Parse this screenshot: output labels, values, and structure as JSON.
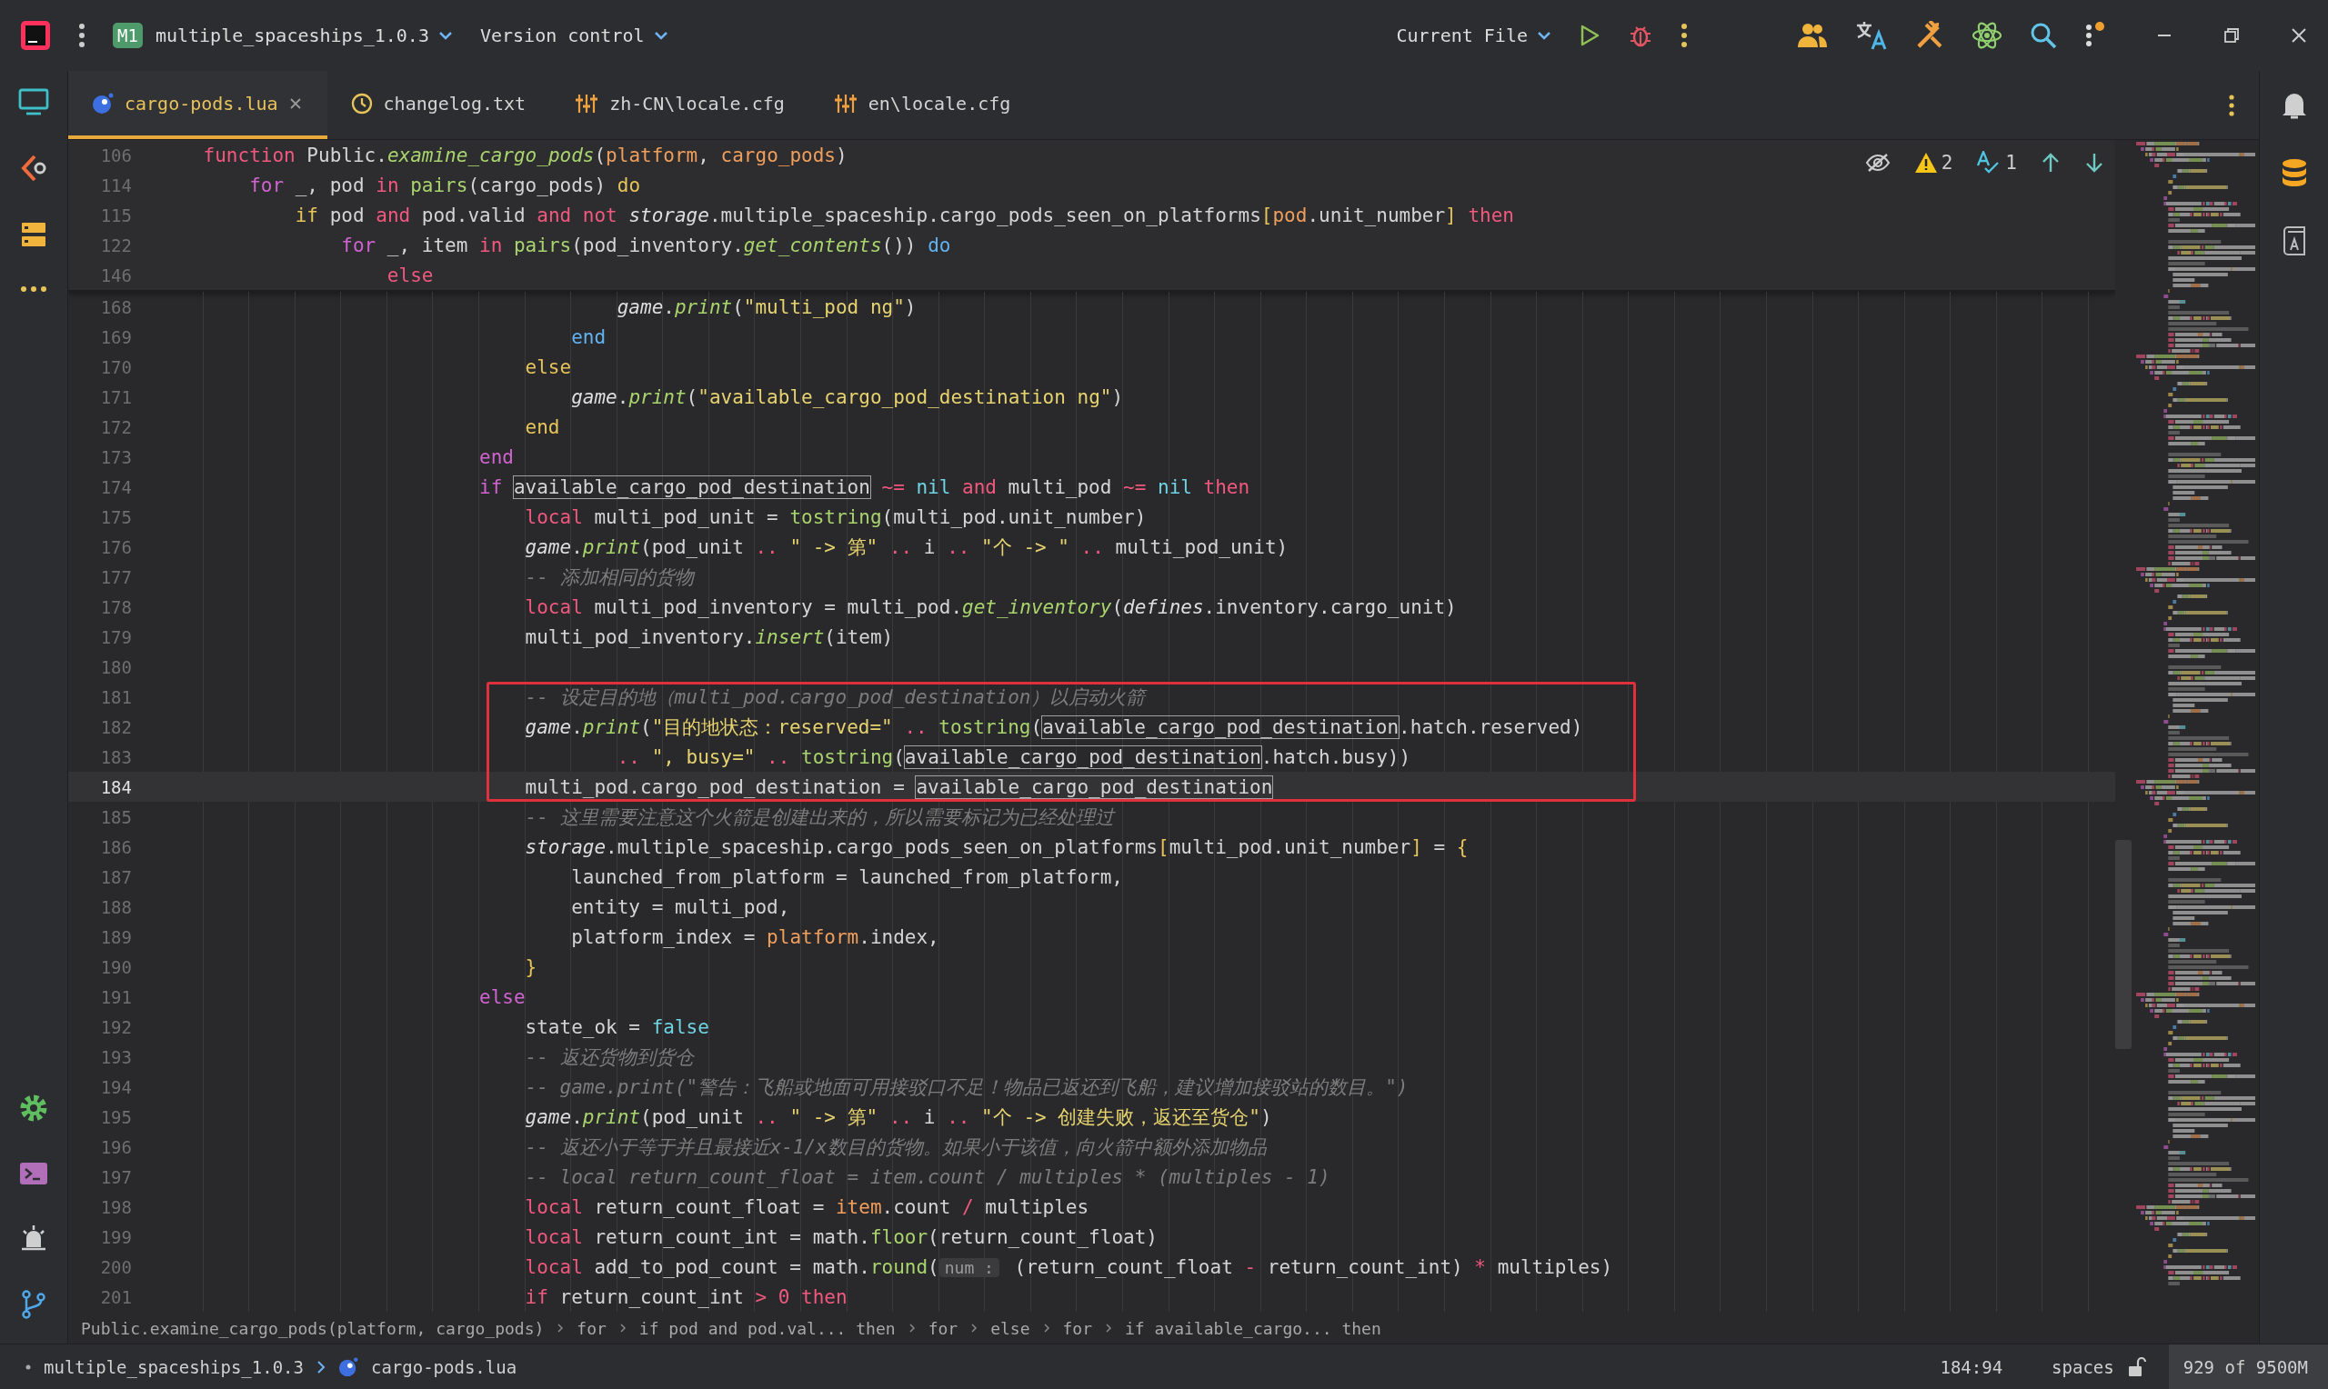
{
  "title_bar": {
    "project_badge": "M1",
    "project": "multiple_spaceships_1.0.3",
    "vcs": "Version control",
    "run_config": "Current File"
  },
  "tabs": [
    {
      "label": "cargo-pods.lua",
      "kind": "lua",
      "selected": true
    },
    {
      "label": "changelog.txt",
      "kind": "history",
      "selected": false
    },
    {
      "label": "zh-CN\\locale.cfg",
      "kind": "cfg",
      "selected": false
    },
    {
      "label": "en\\locale.cfg",
      "kind": "cfg",
      "selected": false
    }
  ],
  "inspections": {
    "warnings": "2",
    "typos": "1"
  },
  "sticky_lines": [
    {
      "number": "106",
      "tokens": [
        {
          "text": "    function",
          "kind": "kw"
        },
        {
          "text": " Public.",
          "kind": "id"
        },
        {
          "text": "examine_cargo_pods",
          "kind": "fn"
        },
        {
          "text": "(",
          "kind": "id"
        },
        {
          "text": "platform",
          "kind": "param"
        },
        {
          "text": ", ",
          "kind": "id"
        },
        {
          "text": "cargo_pods",
          "kind": "param"
        },
        {
          "text": ")",
          "kind": "id"
        }
      ]
    },
    {
      "number": "114",
      "tokens": [
        {
          "text": "        for",
          "kind": "b1"
        },
        {
          "text": " _, pod ",
          "kind": "id"
        },
        {
          "text": "in",
          "kind": "kw"
        },
        {
          "text": " pairs",
          "kind": "call"
        },
        {
          "text": "(cargo_pods)",
          "kind": "id"
        },
        {
          "text": " do",
          "kind": "b2"
        }
      ]
    },
    {
      "number": "115",
      "tokens": [
        {
          "text": "            if",
          "kind": "b2"
        },
        {
          "text": " pod ",
          "kind": "id"
        },
        {
          "text": "and",
          "kind": "kw"
        },
        {
          "text": " pod.valid ",
          "kind": "id"
        },
        {
          "text": "and not",
          "kind": "kw"
        },
        {
          "text": " storage",
          "kind": "glob"
        },
        {
          "text": ".multiple_spaceship.cargo_pods_seen_on_platforms",
          "kind": "id"
        },
        {
          "text": "[",
          "kind": "b2"
        },
        {
          "text": "pod",
          "kind": "param"
        },
        {
          "text": ".unit_number",
          "kind": "id"
        },
        {
          "text": "]",
          "kind": "b2"
        },
        {
          "text": " then",
          "kind": "kw"
        }
      ]
    },
    {
      "number": "122",
      "tokens": [
        {
          "text": "                for",
          "kind": "b1"
        },
        {
          "text": " _, item ",
          "kind": "id"
        },
        {
          "text": "in",
          "kind": "kw"
        },
        {
          "text": " pairs",
          "kind": "call"
        },
        {
          "text": "(pod_inventory.",
          "kind": "id"
        },
        {
          "text": "get_contents",
          "kind": "fn"
        },
        {
          "text": "())",
          "kind": "id"
        },
        {
          "text": " do",
          "kind": "b3"
        }
      ]
    },
    {
      "number": "146",
      "tokens": [
        {
          "text": "                    else",
          "kind": "kw"
        }
      ]
    }
  ],
  "lines": [
    {
      "number": "168",
      "current": false,
      "boxed": false,
      "tokens": [
        {
          "text": "                                        game",
          "kind": "glob"
        },
        {
          "text": ".",
          "kind": "id"
        },
        {
          "text": "print",
          "kind": "fn"
        },
        {
          "text": "(",
          "kind": "id"
        },
        {
          "text": "\"multi_pod ng\"",
          "kind": "str"
        },
        {
          "text": ")",
          "kind": "id"
        }
      ]
    },
    {
      "number": "169",
      "current": false,
      "boxed": false,
      "tokens": [
        {
          "text": "                                    end",
          "kind": "b3"
        }
      ]
    },
    {
      "number": "170",
      "current": false,
      "boxed": false,
      "tokens": [
        {
          "text": "                                else",
          "kind": "b2"
        }
      ]
    },
    {
      "number": "171",
      "current": false,
      "boxed": false,
      "tokens": [
        {
          "text": "                                    game",
          "kind": "glob"
        },
        {
          "text": ".",
          "kind": "id"
        },
        {
          "text": "print",
          "kind": "fn"
        },
        {
          "text": "(",
          "kind": "id"
        },
        {
          "text": "\"available_cargo_pod_destination ng\"",
          "kind": "str"
        },
        {
          "text": ")",
          "kind": "id"
        }
      ]
    },
    {
      "number": "172",
      "current": false,
      "boxed": false,
      "tokens": [
        {
          "text": "                                end",
          "kind": "b2"
        }
      ]
    },
    {
      "number": "173",
      "current": false,
      "boxed": false,
      "tokens": [
        {
          "text": "                            end",
          "kind": "b1"
        }
      ]
    },
    {
      "number": "174",
      "current": false,
      "boxed": false,
      "tokens": [
        {
          "text": "                            if ",
          "kind": "b1"
        },
        {
          "text": "available_cargo_pod_destination",
          "kind": "usage"
        },
        {
          "text": " ~=",
          "kind": "op"
        },
        {
          "text": " nil ",
          "kind": "lit"
        },
        {
          "text": "and",
          "kind": "kw"
        },
        {
          "text": " multi_pod ",
          "kind": "id"
        },
        {
          "text": "~=",
          "kind": "op"
        },
        {
          "text": " nil",
          "kind": "lit"
        },
        {
          "text": " then",
          "kind": "kw"
        }
      ]
    },
    {
      "number": "175",
      "current": false,
      "boxed": false,
      "tokens": [
        {
          "text": "                                local",
          "kind": "kw"
        },
        {
          "text": " multi_pod_unit = ",
          "kind": "id"
        },
        {
          "text": "tostring",
          "kind": "call"
        },
        {
          "text": "(multi_pod.unit_number)",
          "kind": "id"
        }
      ]
    },
    {
      "number": "176",
      "current": false,
      "boxed": false,
      "tokens": [
        {
          "text": "                                game",
          "kind": "glob"
        },
        {
          "text": ".",
          "kind": "id"
        },
        {
          "text": "print",
          "kind": "fn"
        },
        {
          "text": "(pod_unit ",
          "kind": "id"
        },
        {
          "text": "..",
          "kind": "op"
        },
        {
          "text": " \" -> 第\"",
          "kind": "str"
        },
        {
          "text": " ..",
          "kind": "op"
        },
        {
          "text": " i ",
          "kind": "id"
        },
        {
          "text": "..",
          "kind": "op"
        },
        {
          "text": " \"个 -> \"",
          "kind": "str"
        },
        {
          "text": " ..",
          "kind": "op"
        },
        {
          "text": " multi_pod_unit)",
          "kind": "id"
        }
      ]
    },
    {
      "number": "177",
      "current": false,
      "boxed": false,
      "tokens": [
        {
          "text": "                                -- 添加相同的货物",
          "kind": "com"
        }
      ]
    },
    {
      "number": "178",
      "current": false,
      "boxed": false,
      "tokens": [
        {
          "text": "                                local",
          "kind": "kw"
        },
        {
          "text": " multi_pod_inventory = multi_pod.",
          "kind": "id"
        },
        {
          "text": "get_inventory",
          "kind": "fn"
        },
        {
          "text": "(",
          "kind": "id"
        },
        {
          "text": "defines",
          "kind": "glob"
        },
        {
          "text": ".inventory.cargo_unit)",
          "kind": "id"
        }
      ]
    },
    {
      "number": "179",
      "current": false,
      "boxed": false,
      "tokens": [
        {
          "text": "                                multi_pod_inventory.",
          "kind": "id"
        },
        {
          "text": "insert",
          "kind": "fn"
        },
        {
          "text": "(item)",
          "kind": "id"
        }
      ]
    },
    {
      "number": "180",
      "current": false,
      "boxed": false
    },
    {
      "number": "181",
      "current": false,
      "boxed": true,
      "tokens": [
        {
          "text": "                                -- 设定目的地（multi_pod.cargo_pod_destination）以启动火箭",
          "kind": "com"
        }
      ]
    },
    {
      "number": "182",
      "current": false,
      "boxed": true,
      "tokens": [
        {
          "text": "                                game",
          "kind": "glob"
        },
        {
          "text": ".",
          "kind": "id"
        },
        {
          "text": "print",
          "kind": "fn"
        },
        {
          "text": "(",
          "kind": "id"
        },
        {
          "text": "\"目的地状态：reserved=\"",
          "kind": "str"
        },
        {
          "text": " ..",
          "kind": "op"
        },
        {
          "text": " tostring",
          "kind": "call"
        },
        {
          "text": "(",
          "kind": "id"
        },
        {
          "text": "available_cargo_pod_destination",
          "kind": "usage"
        },
        {
          "text": ".hatch.reserved)",
          "kind": "id"
        }
      ]
    },
    {
      "number": "183",
      "current": false,
      "boxed": true,
      "tokens": [
        {
          "text": "                                        ..",
          "kind": "op"
        },
        {
          "text": " \", busy=\" ",
          "kind": "str"
        },
        {
          "text": "..",
          "kind": "op"
        },
        {
          "text": " tostring",
          "kind": "call"
        },
        {
          "text": "(",
          "kind": "id"
        },
        {
          "text": "available_cargo_pod_destination",
          "kind": "usage"
        },
        {
          "text": ".hatch.busy))",
          "kind": "id"
        }
      ]
    },
    {
      "number": "184",
      "current": true,
      "boxed": true,
      "tokens": [
        {
          "text": "                                multi_pod.cargo_pod_destination = ",
          "kind": "id"
        },
        {
          "text": "available_cargo_pod_destination",
          "kind": "usage"
        }
      ]
    },
    {
      "number": "185",
      "current": false,
      "boxed": false,
      "tokens": [
        {
          "text": "                                -- 这里需要注意这个火箭是创建出来的，所以需要标记为已经处理过",
          "kind": "com"
        }
      ]
    },
    {
      "number": "186",
      "current": false,
      "boxed": false,
      "tokens": [
        {
          "text": "                                storage",
          "kind": "glob"
        },
        {
          "text": ".multiple_spaceship.cargo_pods_seen_on_platforms",
          "kind": "id"
        },
        {
          "text": "[",
          "kind": "b2"
        },
        {
          "text": "multi_pod.unit_number",
          "kind": "id"
        },
        {
          "text": "]",
          "kind": "b2"
        },
        {
          "text": " = ",
          "kind": "id"
        },
        {
          "text": "{",
          "kind": "b2"
        }
      ]
    },
    {
      "number": "187",
      "current": false,
      "boxed": false,
      "tokens": [
        {
          "text": "                                    launched_from_platform = launched_from_platform,",
          "kind": "id"
        }
      ]
    },
    {
      "number": "188",
      "current": false,
      "boxed": false,
      "tokens": [
        {
          "text": "                                    entity = multi_pod,",
          "kind": "id"
        }
      ]
    },
    {
      "number": "189",
      "current": false,
      "boxed": false,
      "tokens": [
        {
          "text": "                                    platform_index = ",
          "kind": "id"
        },
        {
          "text": "platform",
          "kind": "param"
        },
        {
          "text": ".index,",
          "kind": "id"
        }
      ]
    },
    {
      "number": "190",
      "current": false,
      "boxed": false,
      "tokens": [
        {
          "text": "                                }",
          "kind": "b2"
        }
      ]
    },
    {
      "number": "191",
      "current": false,
      "boxed": false,
      "tokens": [
        {
          "text": "                            else",
          "kind": "b1"
        }
      ]
    },
    {
      "number": "192",
      "current": false,
      "boxed": false,
      "tokens": [
        {
          "text": "                                state_ok = ",
          "kind": "id"
        },
        {
          "text": "false",
          "kind": "lit"
        }
      ]
    },
    {
      "number": "193",
      "current": false,
      "boxed": false,
      "tokens": [
        {
          "text": "                                -- 返还货物到货仓",
          "kind": "com"
        }
      ]
    },
    {
      "number": "194",
      "current": false,
      "boxed": false,
      "tokens": [
        {
          "text": "                                -- game.print(\"警告：飞船或地面可用接驳口不足！物品已返还到飞船，建议增加接驳站的数目。\")",
          "kind": "com"
        }
      ]
    },
    {
      "number": "195",
      "current": false,
      "boxed": false,
      "tokens": [
        {
          "text": "                                game",
          "kind": "glob"
        },
        {
          "text": ".",
          "kind": "id"
        },
        {
          "text": "print",
          "kind": "fn"
        },
        {
          "text": "(pod_unit ",
          "kind": "id"
        },
        {
          "text": "..",
          "kind": "op"
        },
        {
          "text": " \" -> 第\"",
          "kind": "str"
        },
        {
          "text": " ..",
          "kind": "op"
        },
        {
          "text": " i ",
          "kind": "id"
        },
        {
          "text": "..",
          "kind": "op"
        },
        {
          "text": " \"个 -> 创建失败，返还至货仓\"",
          "kind": "str"
        },
        {
          "text": ")",
          "kind": "id"
        }
      ]
    },
    {
      "number": "196",
      "current": false,
      "boxed": false,
      "tokens": [
        {
          "text": "                                -- 返还小于等于并且最接近x-1/x数目的货物。如果小于该值，向火箭中额外添加物品",
          "kind": "com"
        }
      ]
    },
    {
      "number": "197",
      "current": false,
      "boxed": false,
      "tokens": [
        {
          "text": "                                -- local return_count_float = item.count / multiples * (multiples - 1)",
          "kind": "com"
        }
      ]
    },
    {
      "number": "198",
      "current": false,
      "boxed": false,
      "tokens": [
        {
          "text": "                                local",
          "kind": "kw"
        },
        {
          "text": " return_count_float = ",
          "kind": "id"
        },
        {
          "text": "item",
          "kind": "param"
        },
        {
          "text": ".count ",
          "kind": "id"
        },
        {
          "text": "/",
          "kind": "op"
        },
        {
          "text": " multiples",
          "kind": "id"
        }
      ]
    },
    {
      "number": "199",
      "current": false,
      "boxed": false,
      "tokens": [
        {
          "text": "                                local",
          "kind": "kw"
        },
        {
          "text": " return_count_int = math.",
          "kind": "id"
        },
        {
          "text": "floor",
          "kind": "call"
        },
        {
          "text": "(return_count_float)",
          "kind": "id"
        }
      ]
    },
    {
      "number": "200",
      "current": false,
      "boxed": false,
      "tokens": [
        {
          "text": "                                local",
          "kind": "kw"
        },
        {
          "text": " add_to_pod_count = math.",
          "kind": "id"
        },
        {
          "text": "round",
          "kind": "call"
        },
        {
          "text": "(",
          "kind": "id"
        },
        {
          "text": "num :",
          "kind": "hint"
        },
        {
          "text": " (return_count_float ",
          "kind": "id"
        },
        {
          "text": "-",
          "kind": "op"
        },
        {
          "text": " return_count_int) ",
          "kind": "id"
        },
        {
          "text": "*",
          "kind": "op"
        },
        {
          "text": " multiples)",
          "kind": "id"
        }
      ]
    },
    {
      "number": "201",
      "current": false,
      "boxed": false,
      "tokens": [
        {
          "text": "                                if",
          "kind": "kw"
        },
        {
          "text": " return_count_int ",
          "kind": "id"
        },
        {
          "text": ">",
          "kind": "op"
        },
        {
          "text": " 0",
          "kind": "num"
        },
        {
          "text": " then",
          "kind": "kw"
        }
      ]
    }
  ],
  "breadcrumbs": [
    "Public.examine_cargo_pods(platform, cargo_pods)",
    "for",
    "if pod and pod.val... then",
    "for",
    "else",
    "for",
    "if available_cargo... then"
  ],
  "status_bar": {
    "path": [
      "multiple_spaceships_1.0.3",
      "cargo-pods.lua"
    ],
    "position": "184:94",
    "indent": "spaces",
    "memory": "929 of 9500M"
  }
}
